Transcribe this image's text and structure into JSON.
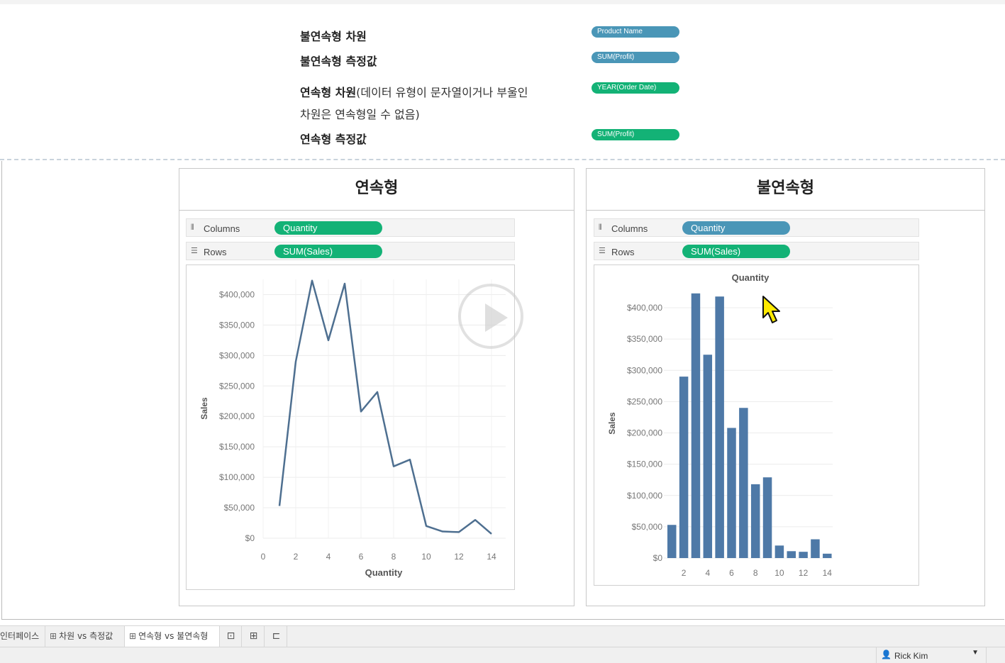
{
  "legend": {
    "rows": [
      {
        "label": "불연속형 차원",
        "rest": "",
        "pill": "Product Name",
        "pill_color": "#4a96b7"
      },
      {
        "label": "불연속형 측정값",
        "rest": "",
        "pill": "SUM(Profit)",
        "pill_color": "#4a96b7"
      },
      {
        "label": "연속형 차원",
        "rest": "(데이터 유형이 문자열이거나 부울인",
        "pill": "YEAR(Order Date)",
        "pill_color": "#13b276"
      },
      {
        "label": "연속형 측정값",
        "rest": "",
        "pill": "SUM(Profit)",
        "pill_color": "#13b276"
      }
    ],
    "continued_line": "차원은 연속형일 수 없음)"
  },
  "panels": {
    "left": {
      "title": "연속형",
      "columns_label": "Columns",
      "columns_pill": "Quantity",
      "rows_label": "Rows",
      "rows_pill": "SUM(Sales)",
      "pill_color": "#13b276"
    },
    "right": {
      "title": "불연속형",
      "columns_label": "Columns",
      "columns_pill": "Quantity",
      "columns_pill_color": "#4a96b7",
      "rows_label": "Rows",
      "rows_pill": "SUM(Sales)",
      "rows_pill_color": "#13b276"
    }
  },
  "chart_data": [
    {
      "type": "line",
      "x": [
        1,
        2,
        3,
        4,
        5,
        6,
        7,
        8,
        9,
        10,
        11,
        12,
        13,
        14
      ],
      "series": [
        {
          "values": [
            53000,
            290000,
            423000,
            325000,
            418000,
            208000,
            240000,
            118000,
            129000,
            20000,
            11000,
            10000,
            30000,
            7000
          ]
        }
      ],
      "xlabel": "Quantity",
      "ylabel": "Sales",
      "xlim": [
        0,
        14
      ],
      "ylim": [
        0,
        425000
      ],
      "xticks": [
        "0",
        "2",
        "4",
        "6",
        "8",
        "10",
        "12",
        "14"
      ],
      "yticks": [
        "$0",
        "$50,000",
        "$100,000",
        "$150,000",
        "$200,000",
        "$250,000",
        "$300,000",
        "$350,000",
        "$400,000"
      ],
      "color": "#4e6f90",
      "grid": true
    },
    {
      "type": "bar",
      "categories": [
        "1",
        "2",
        "3",
        "4",
        "5",
        "6",
        "7",
        "8",
        "9",
        "10",
        "11",
        "12",
        "13",
        "14"
      ],
      "values": [
        53000,
        290000,
        423000,
        325000,
        418000,
        208000,
        240000,
        118000,
        129000,
        20000,
        11000,
        10000,
        30000,
        7000
      ],
      "title": "Quantity",
      "ylabel": "Sales",
      "ylim": [
        0,
        425000
      ],
      "xticks": [
        "2",
        "4",
        "6",
        "8",
        "10",
        "12",
        "14"
      ],
      "yticks": [
        "$0",
        "$50,000",
        "$100,000",
        "$150,000",
        "$200,000",
        "$250,000",
        "$300,000",
        "$350,000",
        "$400,000"
      ],
      "color": "#4e79a7",
      "grid": true
    }
  ],
  "tabs": {
    "items": [
      {
        "label": "인터페이스",
        "icon": ""
      },
      {
        "label": "차원 vs 측정값",
        "icon": "grid-icon"
      },
      {
        "label": "연속형 vs 불연속형",
        "icon": "grid-icon"
      }
    ],
    "new_sheet_icon": "new-worksheet-icon",
    "new_dashboard_icon": "new-dashboard-icon",
    "new_story_icon": "new-story-icon"
  },
  "status": {
    "user": "Rick Kim"
  }
}
